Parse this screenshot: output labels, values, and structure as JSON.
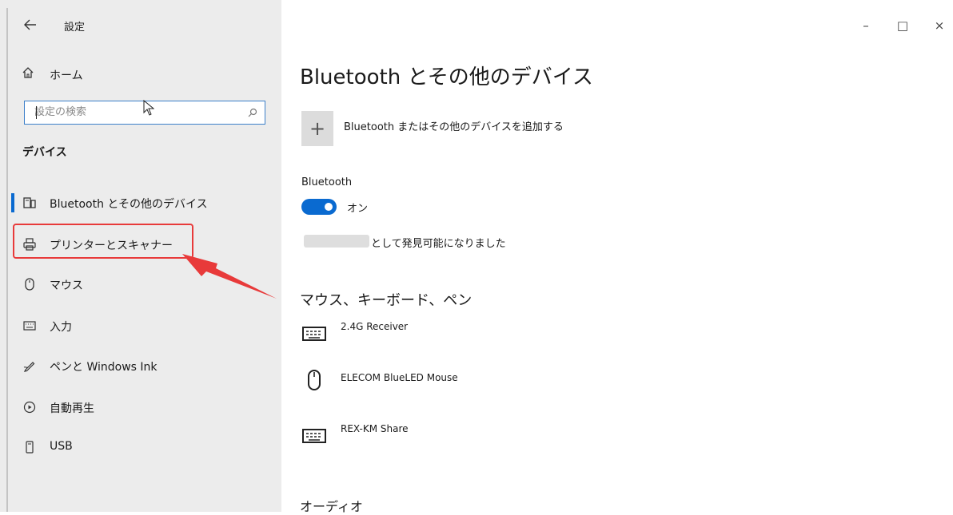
{
  "window": {
    "title": "設定",
    "controls": {
      "minimize": "–",
      "maximize": "□",
      "close": "×"
    }
  },
  "sidebar": {
    "home_label": "ホーム",
    "search": {
      "placeholder": "設定の検索"
    },
    "section_title": "デバイス",
    "items": [
      {
        "label": "Bluetooth とその他のデバイス",
        "icon": "device-icon",
        "active": true
      },
      {
        "label": "プリンターとスキャナー",
        "icon": "printer-icon"
      },
      {
        "label": "マウス",
        "icon": "mouse-icon"
      },
      {
        "label": "入力",
        "icon": "keyboard-icon"
      },
      {
        "label": "ペンと Windows Ink",
        "icon": "pen-icon"
      },
      {
        "label": "自動再生",
        "icon": "autoplay-icon"
      },
      {
        "label": "USB",
        "icon": "usb-icon"
      }
    ]
  },
  "main": {
    "title": "Bluetooth とその他のデバイス",
    "add_device_label": "Bluetooth またはその他のデバイスを追加する",
    "bluetooth": {
      "label": "Bluetooth",
      "state": "オン"
    },
    "discoverable_text": "として発見可能になりました",
    "mouse_keyboard_pen_heading": "マウス、キーボード、ペン",
    "devices": [
      {
        "name": "2.4G Receiver",
        "icon": "keyboard-icon"
      },
      {
        "name": "ELECOM BlueLED Mouse",
        "icon": "mouse-icon"
      },
      {
        "name": "REX-KM Share",
        "icon": "keyboard-icon"
      }
    ],
    "audio_heading": "オーディオ"
  },
  "colors": {
    "accent": "#0a6ad0",
    "highlight": "#e83a3a",
    "sidebar_bg": "#ececec"
  }
}
